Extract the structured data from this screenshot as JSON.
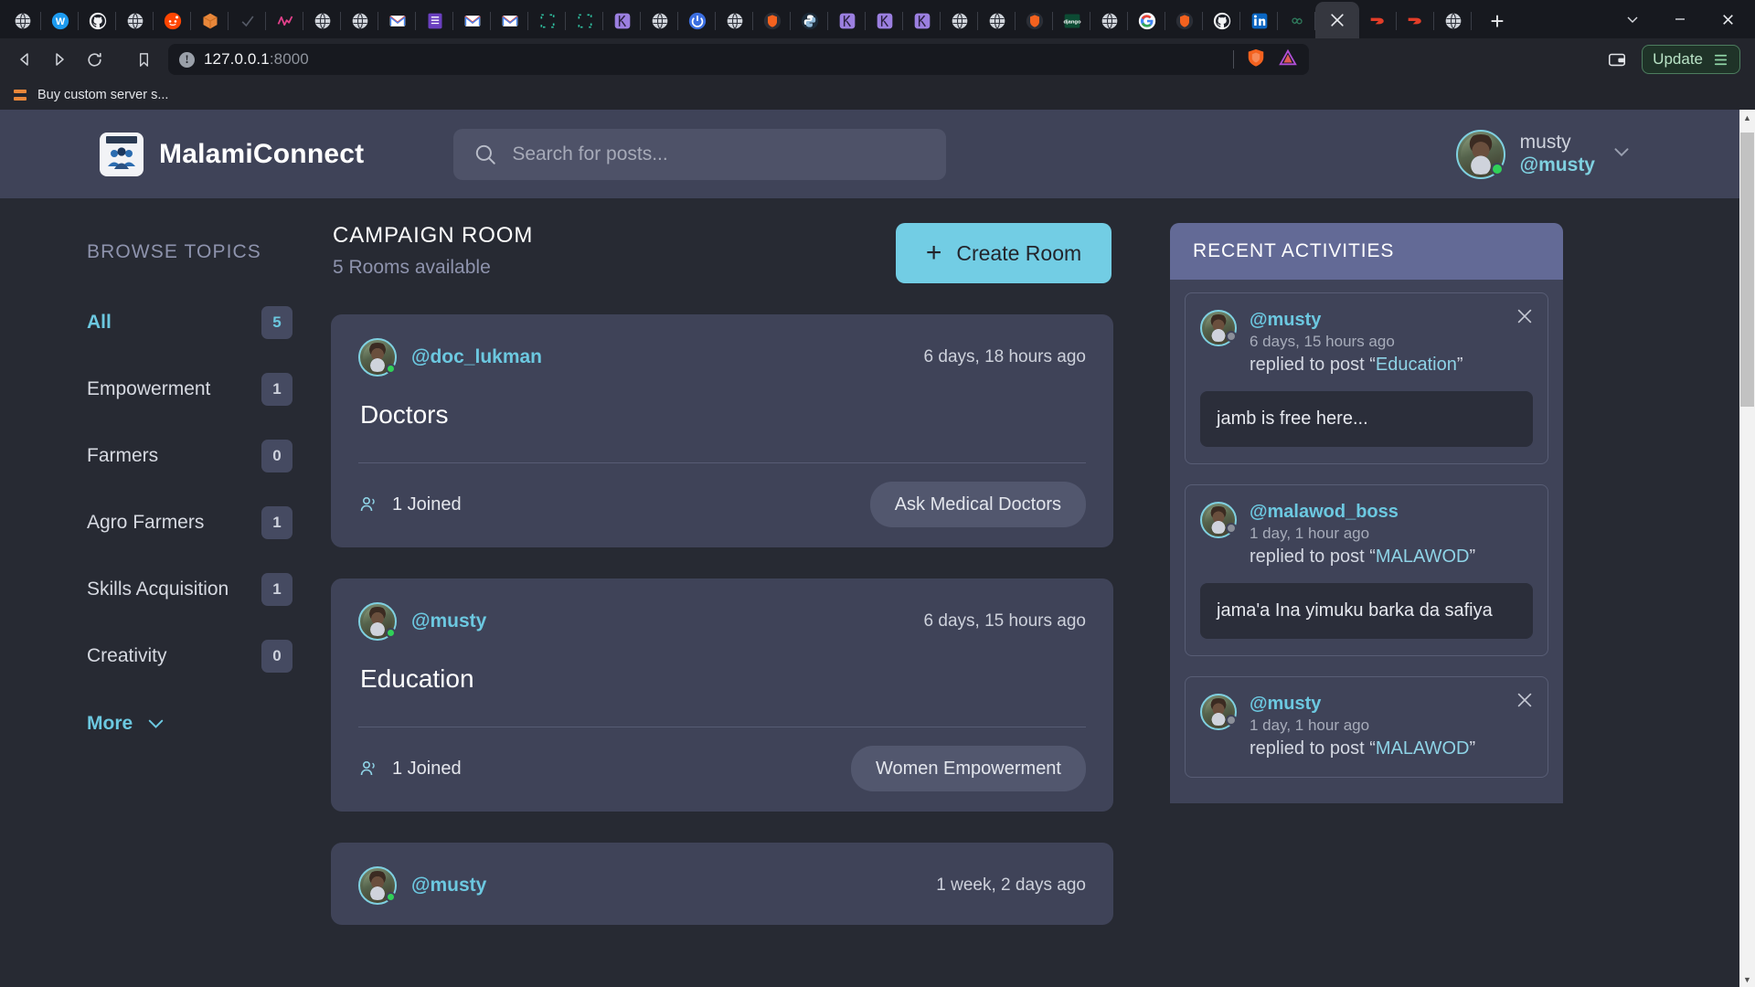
{
  "browser": {
    "tabs": [
      {
        "name": "brave-globe-tab",
        "color": "#2c2f38",
        "glyph": "globe"
      },
      {
        "name": "twitter-tab",
        "color": "#1d2a3a",
        "glyph": "w"
      },
      {
        "name": "github-tab",
        "color": "#1c1f27",
        "glyph": "gh"
      },
      {
        "name": "globe-tab-2",
        "color": "#2c2f38",
        "glyph": "globe"
      },
      {
        "name": "reddit-tab",
        "color": "#ff4500",
        "glyph": "r"
      },
      {
        "name": "package-tab",
        "color": "#e8873a",
        "glyph": "box"
      },
      {
        "name": "check-tab",
        "color": "#2c2f38",
        "glyph": "check"
      },
      {
        "name": "analytics-tab",
        "color": "#e0408a",
        "glyph": "wave"
      },
      {
        "name": "globe-tab-3",
        "color": "#2c2f38",
        "glyph": "globe"
      },
      {
        "name": "globe-tab-4",
        "color": "#2c2f38",
        "glyph": "globe"
      },
      {
        "name": "gmail-tab-1",
        "color": "#ffffff",
        "glyph": "M"
      },
      {
        "name": "list-tab",
        "color": "#6a3fbf",
        "glyph": "list"
      },
      {
        "name": "gmail-tab-2",
        "color": "#ffffff",
        "glyph": "M"
      },
      {
        "name": "gmail-tab-3",
        "color": "#ffffff",
        "glyph": "M"
      },
      {
        "name": "figma-tab-1",
        "color": "#1c1f27",
        "glyph": "dash"
      },
      {
        "name": "figma-tab-2",
        "color": "#1c1f27",
        "glyph": "dash"
      },
      {
        "name": "heroku-tab-1",
        "color": "#9b7fe0",
        "glyph": "K"
      },
      {
        "name": "globe-tab-5",
        "color": "#2c2f38",
        "glyph": "globe"
      },
      {
        "name": "power-tab",
        "color": "#3b6ee0",
        "glyph": "power"
      },
      {
        "name": "globe-tab-6",
        "color": "#2c2f38",
        "glyph": "globe"
      },
      {
        "name": "brave-tab-1",
        "color": "#1c1f27",
        "glyph": "brave"
      },
      {
        "name": "python-tab",
        "color": "#1c1f27",
        "glyph": "py"
      },
      {
        "name": "heroku-tab-2",
        "color": "#9b7fe0",
        "glyph": "K"
      },
      {
        "name": "heroku-tab-3",
        "color": "#9b7fe0",
        "glyph": "K"
      },
      {
        "name": "heroku-tab-4",
        "color": "#9b7fe0",
        "glyph": "K"
      },
      {
        "name": "globe-tab-7",
        "color": "#2c2f38",
        "glyph": "globe"
      },
      {
        "name": "globe-tab-8",
        "color": "#2c2f38",
        "glyph": "globe"
      },
      {
        "name": "brave-tab-2",
        "color": "#1c1f27",
        "glyph": "brave"
      },
      {
        "name": "django-tab",
        "color": "#0c4b33",
        "glyph": "dj"
      },
      {
        "name": "globe-tab-9",
        "color": "#2c2f38",
        "glyph": "globe"
      },
      {
        "name": "google-tab",
        "color": "#ffffff",
        "glyph": "G"
      },
      {
        "name": "brave-tab-3",
        "color": "#1c1f27",
        "glyph": "brave"
      },
      {
        "name": "github-tab-2",
        "color": "#ffffff",
        "glyph": "gh2"
      },
      {
        "name": "linkedin-tab",
        "color": "#0a66c2",
        "glyph": "in"
      },
      {
        "name": "infinity-tab",
        "color": "#1c1f27",
        "glyph": "inf"
      },
      {
        "name": "active-tab",
        "color": "#35373f",
        "glyph": "x",
        "active": true
      },
      {
        "name": "doordash-tab-1",
        "color": "#1c1f27",
        "glyph": "dd"
      },
      {
        "name": "doordash-tab-2",
        "color": "#1c1f27",
        "glyph": "dd"
      },
      {
        "name": "globe-tab-10",
        "color": "#2c2f38",
        "glyph": "globe"
      }
    ],
    "new_tab_label": "+",
    "window_controls": {
      "minimize": "⌄",
      "restore": "─",
      "close": "✕"
    },
    "nav": {
      "back": "back-arrow",
      "forward": "forward-arrow",
      "reload": "reload-arrow",
      "bookmark": "bookmark-icon"
    },
    "url": {
      "host": "127.0.0.1",
      "port": ":8000",
      "security_label": "!"
    },
    "wallet_icon": "wallet-icon",
    "update_label": "Update",
    "bookmark_item": "Buy custom server s..."
  },
  "app": {
    "brand": "MalamiConnect",
    "search_placeholder": "Search for posts...",
    "profile": {
      "name": "musty",
      "handle": "@musty"
    }
  },
  "sidebar": {
    "title": "BROWSE TOPICS",
    "items": [
      {
        "label": "All",
        "count": "5",
        "active": true
      },
      {
        "label": "Empowerment",
        "count": "1",
        "active": false
      },
      {
        "label": "Farmers",
        "count": "0",
        "active": false
      },
      {
        "label": "Agro Farmers",
        "count": "1",
        "active": false
      },
      {
        "label": "Skills Acquisition",
        "count": "1",
        "active": false
      },
      {
        "label": "Creativity",
        "count": "0",
        "active": false
      }
    ],
    "more_label": "More"
  },
  "main": {
    "title": "CAMPAIGN ROOM",
    "subtitle": "5 Rooms available",
    "create_button": "Create Room",
    "rooms": [
      {
        "handle": "@doc_lukman",
        "time": "6 days, 18 hours ago",
        "title": "Doctors",
        "joined": "1 Joined",
        "tag": "Ask Medical Doctors",
        "online": true
      },
      {
        "handle": "@musty",
        "time": "6 days, 15 hours ago",
        "title": "Education",
        "joined": "1 Joined",
        "tag": "Women Empowerment",
        "online": true
      },
      {
        "handle": "@musty",
        "time": "1 week, 2 days ago",
        "title": "",
        "joined": "",
        "tag": "",
        "online": true
      }
    ]
  },
  "activities": {
    "title": "RECENT ACTIVITIES",
    "items": [
      {
        "handle": "@musty",
        "time": "6 days, 15 hours ago",
        "action_prefix": "replied to post “",
        "action_target": "Education",
        "action_suffix": "”",
        "message": "jamb is free here...",
        "has_close": true
      },
      {
        "handle": "@malawod_boss",
        "time": "1 day, 1 hour ago",
        "action_prefix": "replied to post “",
        "action_target": "MALAWOD",
        "action_suffix": "”",
        "message": "jama'a Ina yimuku barka da safiya",
        "has_close": false
      },
      {
        "handle": "@musty",
        "time": "1 day, 1 hour ago",
        "action_prefix": "replied to post “",
        "action_target": "MALAWOD",
        "action_suffix": "”",
        "message": "",
        "has_close": true
      }
    ]
  },
  "colors": {
    "page_bg": "#272a33",
    "panel_bg": "#3f4358",
    "accent_cyan": "#6cc8e0",
    "create_btn": "#72cde4",
    "activities_header": "#636a96",
    "online_green": "#30d158"
  }
}
